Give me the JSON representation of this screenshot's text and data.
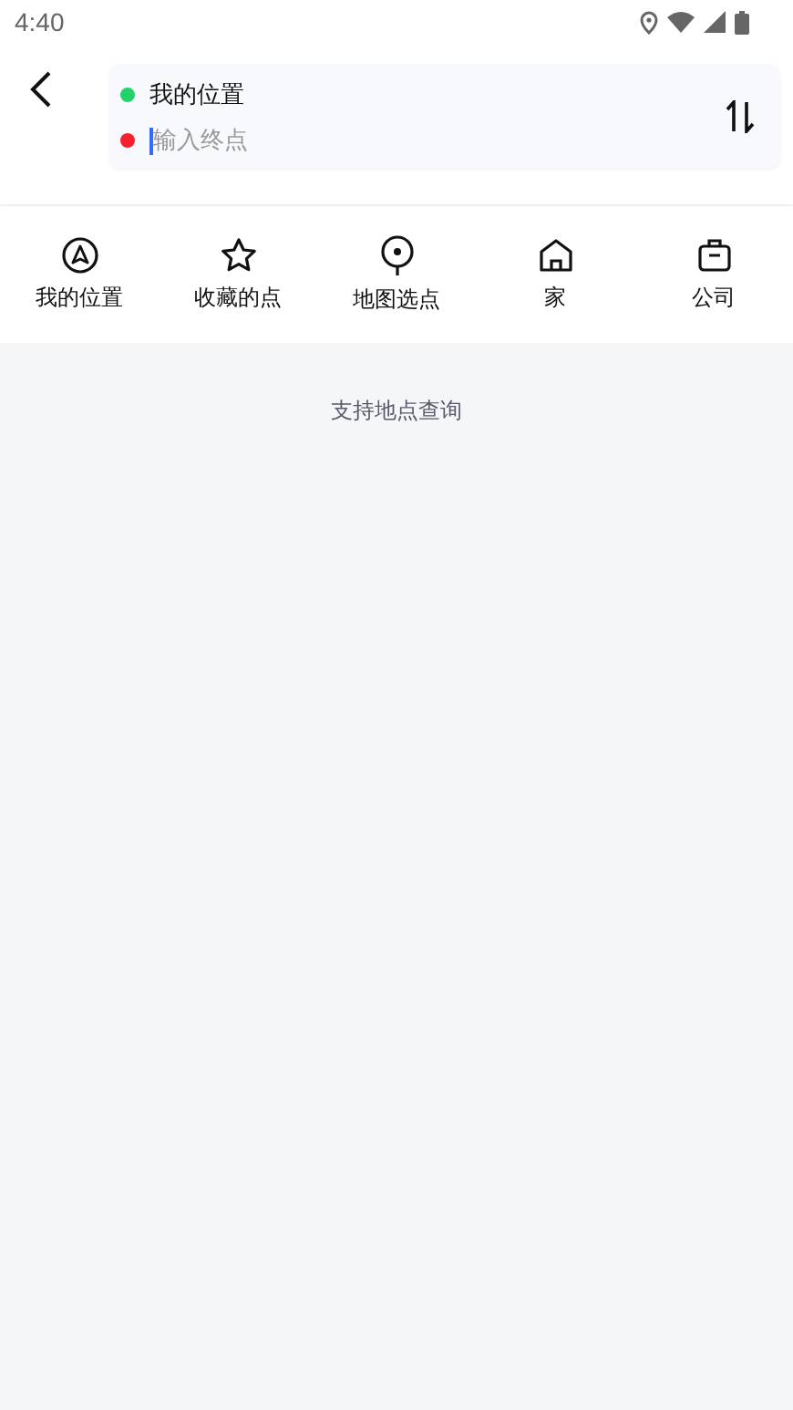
{
  "status_bar": {
    "time": "4:40"
  },
  "route": {
    "start": {
      "value": "我的位置",
      "color": "#22d36b"
    },
    "end": {
      "placeholder": "输入终点",
      "color": "#f5222d"
    }
  },
  "shortcuts": [
    {
      "kind": "location",
      "label": "我的位置"
    },
    {
      "kind": "star",
      "label": "收藏的点"
    },
    {
      "kind": "pin",
      "label": "地图选点"
    },
    {
      "kind": "home",
      "label": "家"
    },
    {
      "kind": "work",
      "label": "公司"
    }
  ],
  "hint": "支持地点查询"
}
